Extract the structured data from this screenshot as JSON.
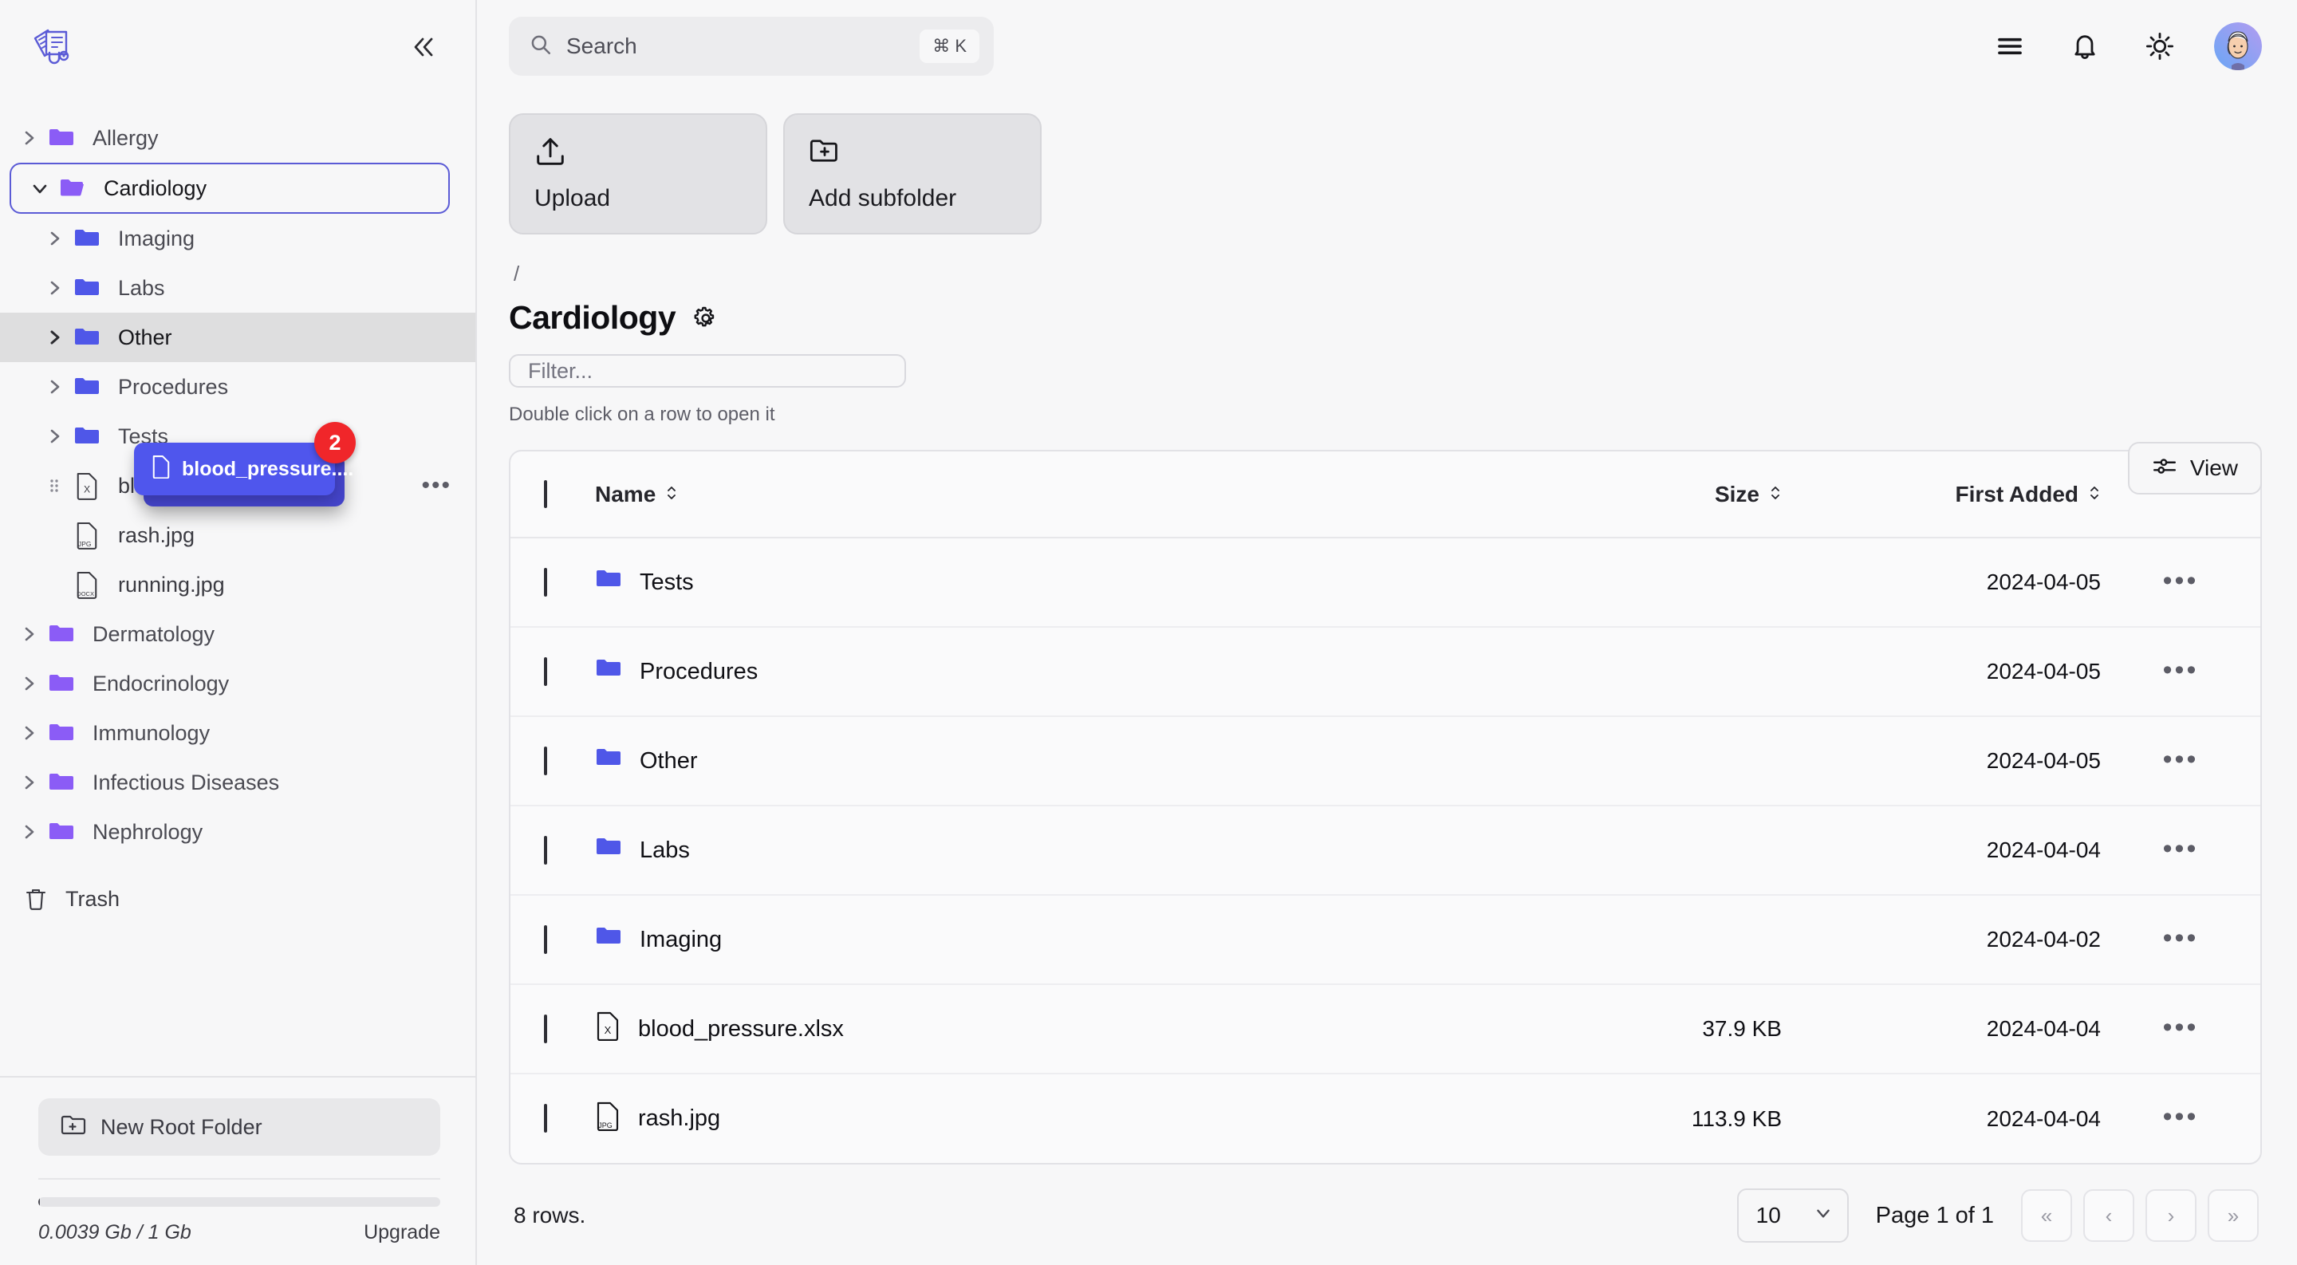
{
  "sidebar": {
    "logo_name": "medical-records-logo",
    "collapse_label": "«",
    "tree": [
      {
        "label": "Allergy",
        "depth": 0,
        "type": "folder",
        "state": "collapsed",
        "accent": "purple"
      },
      {
        "label": "Cardiology",
        "depth": 0,
        "type": "folder",
        "state": "expanded",
        "accent": "purple",
        "selected": true
      },
      {
        "label": "Imaging",
        "depth": 1,
        "type": "folder",
        "state": "collapsed",
        "accent": "blue"
      },
      {
        "label": "Labs",
        "depth": 1,
        "type": "folder",
        "state": "collapsed",
        "accent": "blue"
      },
      {
        "label": "Other",
        "depth": 1,
        "type": "folder",
        "state": "collapsed",
        "accent": "blue",
        "highlight": true
      },
      {
        "label": "Procedures",
        "depth": 1,
        "type": "folder",
        "state": "collapsed",
        "accent": "blue"
      },
      {
        "label": "Tests",
        "depth": 1,
        "type": "folder",
        "state": "collapsed",
        "accent": "blue"
      }
    ],
    "files": [
      {
        "name": "blood_pressure.xlsx",
        "ext": "X",
        "grip": true,
        "more": "•••"
      },
      {
        "name": "rash.jpg",
        "ext": "JPG",
        "grip": false
      },
      {
        "name": "running.jpg",
        "ext": "DOCX",
        "grip": false
      }
    ],
    "tree_bottom": [
      {
        "label": "Dermatology",
        "depth": 0,
        "type": "folder",
        "state": "collapsed",
        "accent": "purple"
      },
      {
        "label": "Endocrinology",
        "depth": 0,
        "type": "folder",
        "state": "collapsed",
        "accent": "purple"
      },
      {
        "label": "Immunology",
        "depth": 0,
        "type": "folder",
        "state": "collapsed",
        "accent": "purple"
      },
      {
        "label": "Infectious Diseases",
        "depth": 0,
        "type": "folder",
        "state": "collapsed",
        "accent": "purple"
      },
      {
        "label": "Nephrology",
        "depth": 0,
        "type": "folder",
        "state": "collapsed",
        "accent": "purple"
      }
    ],
    "trash_label": "Trash",
    "new_root_label": "New Root Folder",
    "quota_text": "0.0039 Gb / 1 Gb",
    "quota_percent": 0.39,
    "upgrade_label": "Upgrade"
  },
  "drag": {
    "label": "blood_pressure....",
    "badge_count": "2",
    "color": "#4f56ed",
    "badge_color": "#f0262a"
  },
  "search": {
    "placeholder": "Search",
    "shortcut": "⌘ K"
  },
  "topbar": {
    "menu_icon": "hamburger-icon",
    "bell_icon": "bell-icon",
    "theme_icon": "sun-icon",
    "avatar_name": "user-avatar"
  },
  "actions": {
    "upload_label": "Upload",
    "add_subfolder_label": "Add subfolder"
  },
  "breadcrumb": "/",
  "page_title": "Cardiology",
  "filter_placeholder": "Filter...",
  "hint": "Double click on a row to open it",
  "view_label": "View",
  "table": {
    "columns": [
      "Name",
      "Size",
      "First Added"
    ],
    "rows": [
      {
        "name": "Tests",
        "kind": "folder",
        "ext": "",
        "size": "",
        "date": "2024-04-05"
      },
      {
        "name": "Procedures",
        "kind": "folder",
        "ext": "",
        "size": "",
        "date": "2024-04-05"
      },
      {
        "name": "Other",
        "kind": "folder",
        "ext": "",
        "size": "",
        "date": "2024-04-05"
      },
      {
        "name": "Labs",
        "kind": "folder",
        "ext": "",
        "size": "",
        "date": "2024-04-04"
      },
      {
        "name": "Imaging",
        "kind": "folder",
        "ext": "",
        "size": "",
        "date": "2024-04-02"
      },
      {
        "name": "blood_pressure.xlsx",
        "kind": "file",
        "ext": "X",
        "size": "37.9 KB",
        "date": "2024-04-04"
      },
      {
        "name": "rash.jpg",
        "kind": "file",
        "ext": "JPG",
        "size": "113.9 KB",
        "date": "2024-04-04"
      }
    ],
    "row_more": "•••"
  },
  "footer": {
    "rows_text": "8 rows.",
    "page_size": "10",
    "page_of": "Page 1 of 1",
    "pg_first": "«",
    "pg_prev": "‹",
    "pg_next": "›",
    "pg_last": "»"
  },
  "colors": {
    "accent_purple": "#8b5cf6",
    "accent_blue": "#4f57e8",
    "selected_border": "#5b5bd6",
    "danger": "#f0262a"
  }
}
